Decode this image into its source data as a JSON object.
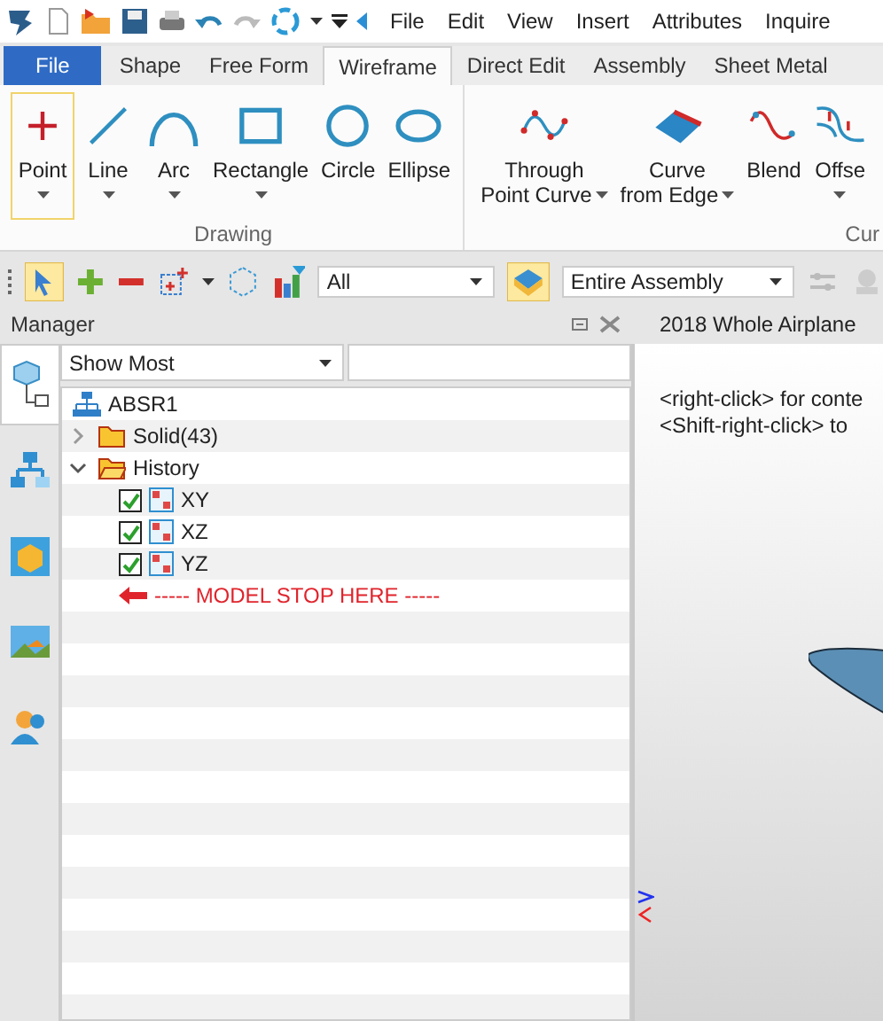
{
  "menu": [
    "File",
    "Edit",
    "View",
    "Insert",
    "Attributes",
    "Inquire"
  ],
  "tabs": [
    {
      "label": "File",
      "kind": "file",
      "selected": false
    },
    {
      "label": "Shape",
      "kind": "tab",
      "selected": false
    },
    {
      "label": "Free Form",
      "kind": "tab",
      "selected": false
    },
    {
      "label": "Wireframe",
      "kind": "tab",
      "selected": true
    },
    {
      "label": "Direct Edit",
      "kind": "tab",
      "selected": false
    },
    {
      "label": "Assembly",
      "kind": "tab",
      "selected": false
    },
    {
      "label": "Sheet Metal",
      "kind": "tab",
      "selected": false
    }
  ],
  "ribbon": [
    {
      "label": "Drawing",
      "tools": [
        {
          "lines": [
            "Point"
          ],
          "kind": "point",
          "dropdown": true,
          "selected": true
        },
        {
          "lines": [
            "Line"
          ],
          "kind": "line",
          "dropdown": true,
          "selected": false
        },
        {
          "lines": [
            "Arc"
          ],
          "kind": "arc",
          "dropdown": true,
          "selected": false
        },
        {
          "lines": [
            "Rectangle"
          ],
          "kind": "rectangle",
          "dropdown": true,
          "selected": false
        },
        {
          "lines": [
            "Circle"
          ],
          "kind": "circle",
          "dropdown": false,
          "selected": false
        },
        {
          "lines": [
            "Ellipse"
          ],
          "kind": "ellipse",
          "dropdown": false,
          "selected": false
        }
      ]
    },
    {
      "label": "Cur",
      "tools": [
        {
          "lines": [
            "Through",
            "Point Curve"
          ],
          "kind": "spline",
          "dropdown": true,
          "selected": false
        },
        {
          "lines": [
            "Curve",
            "from Edge"
          ],
          "kind": "surface",
          "dropdown": true,
          "selected": false
        },
        {
          "lines": [
            "Blend"
          ],
          "kind": "blend",
          "dropdown": false,
          "selected": false
        },
        {
          "lines": [
            "Offse"
          ],
          "kind": "offset",
          "dropdown": true,
          "selected": false
        }
      ]
    }
  ],
  "toolbar": {
    "filter": "All",
    "scope": "Entire Assembly"
  },
  "manager": {
    "title": "Manager",
    "side_tabs": [
      {
        "selected": true
      },
      {
        "selected": false
      },
      {
        "selected": false
      },
      {
        "selected": false
      },
      {
        "selected": false
      }
    ],
    "show": "Show Most",
    "tree": [
      {
        "label": "ABSR1",
        "kind": "assembly",
        "children": [
          {
            "label": "Solid(43)",
            "kind": "folder",
            "expanded": false
          },
          {
            "label": "History",
            "kind": "folder",
            "expanded": true,
            "children": [
              {
                "label": "XY",
                "kind": "plane",
                "checked": true
              },
              {
                "label": "XZ",
                "kind": "plane",
                "checked": true
              },
              {
                "label": "YZ",
                "kind": "plane",
                "checked": true
              },
              {
                "label": "----- MODEL STOP HERE -----",
                "kind": "stop-marker"
              }
            ]
          }
        ]
      }
    ]
  },
  "viewport": {
    "title": "2018 Whole Airplane",
    "hints": [
      "<right-click> for conte",
      "<Shift-right-click> to"
    ]
  }
}
